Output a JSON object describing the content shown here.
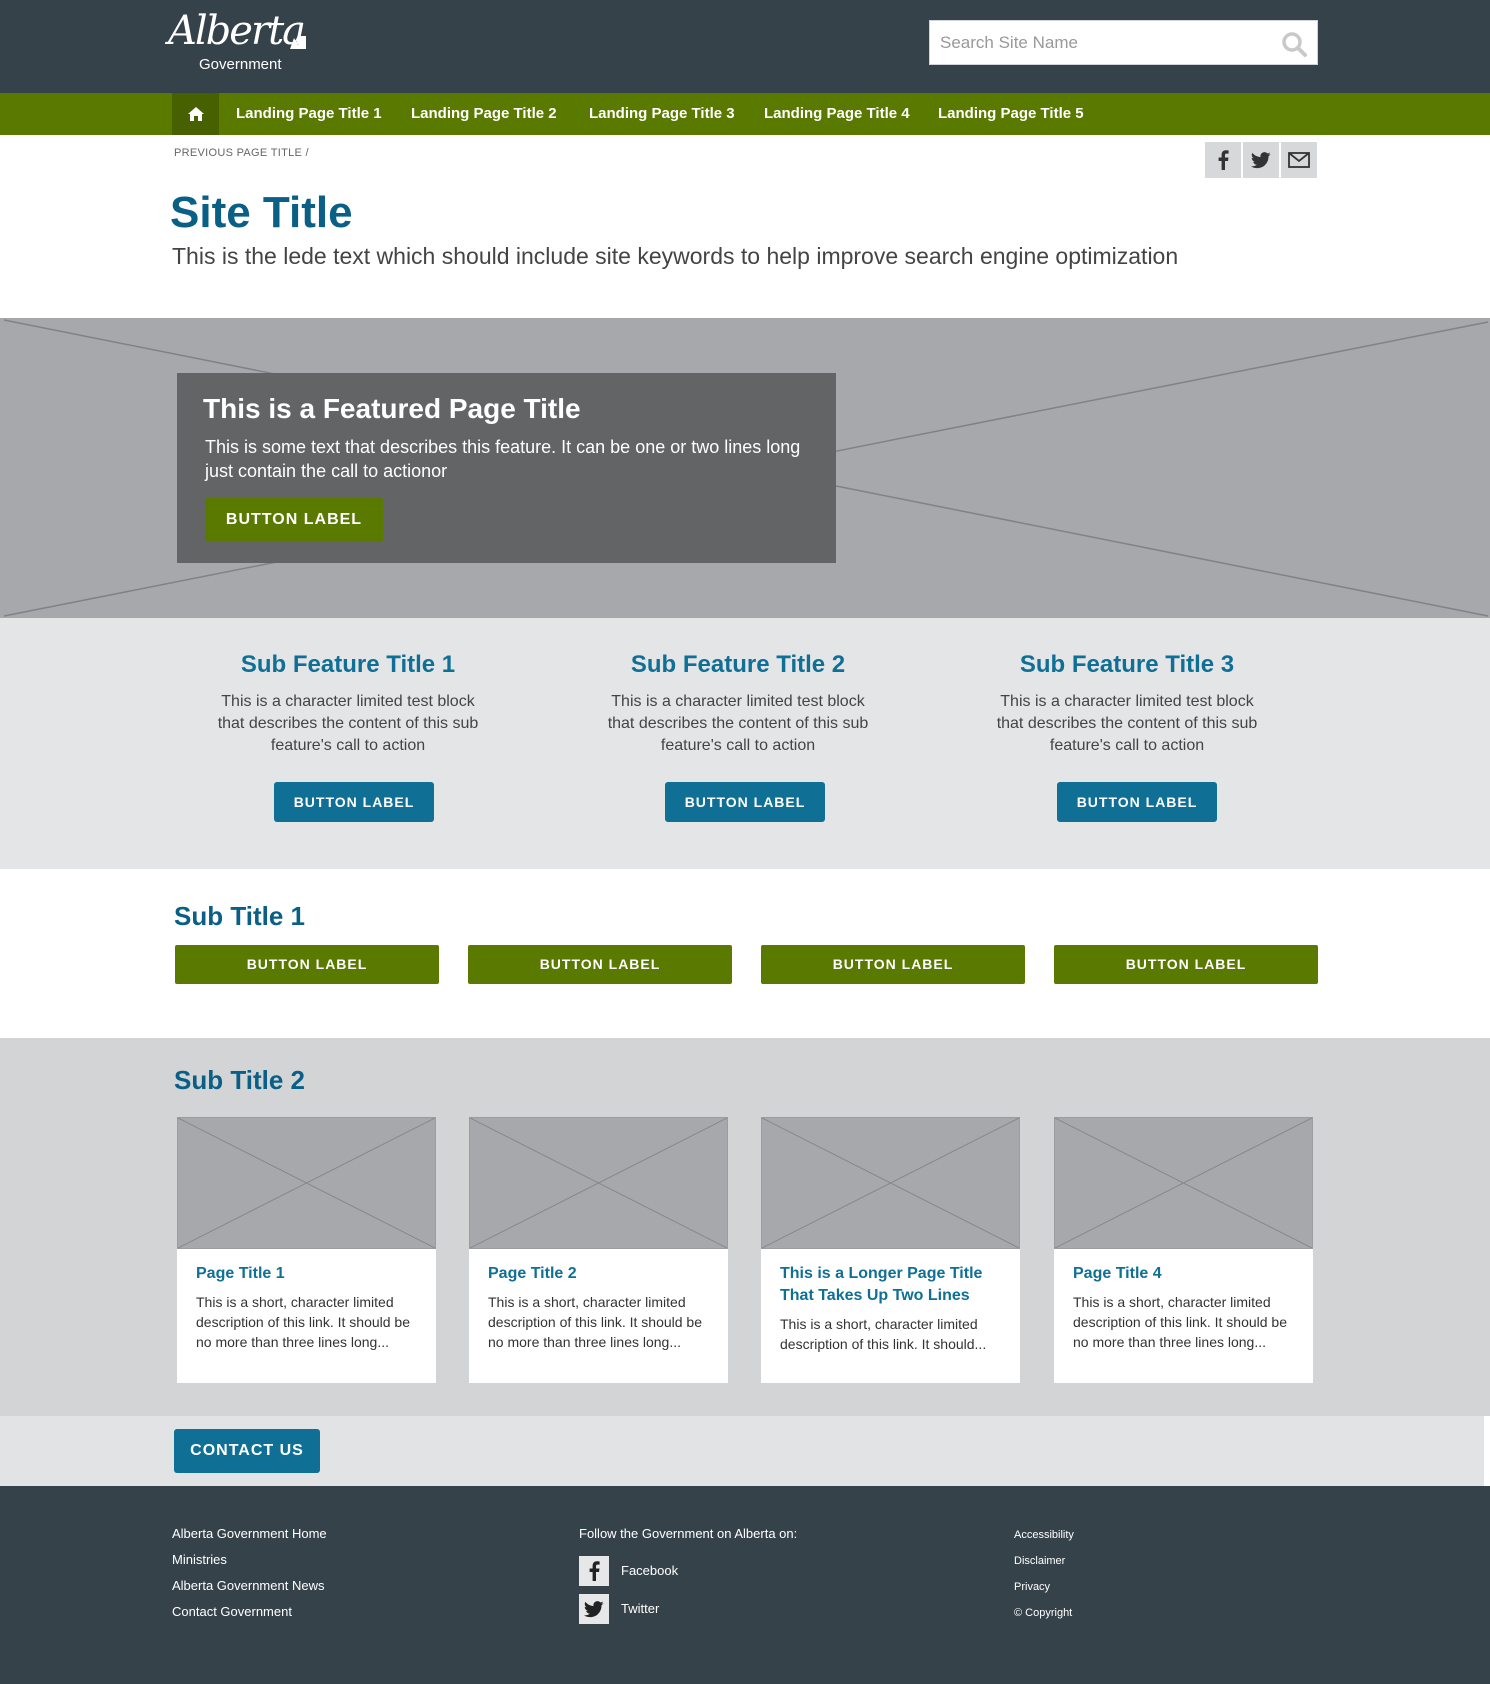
{
  "header": {
    "logo_text": "Alberta",
    "logo_sub": "Government",
    "search_placeholder": "Search Site Name"
  },
  "nav": {
    "items": [
      {
        "label": "Landing Page Title 1"
      },
      {
        "label": "Landing Page Title 2"
      },
      {
        "label": "Landing Page Title 3"
      },
      {
        "label": "Landing Page Title 4"
      },
      {
        "label": "Landing Page Title 5"
      }
    ]
  },
  "breadcrumb": "PREVIOUS PAGE TITLE  /",
  "page": {
    "title": "Site Title",
    "lede": "This is the lede text which should include site keywords to help improve search engine optimization"
  },
  "featured": {
    "title": "This is a Featured Page Title",
    "text": "This is some text that describes this feature. It can be one or two lines long just contain the call to actionor",
    "button": "BUTTON LABEL"
  },
  "subfeatures": [
    {
      "title": "Sub Feature Title 1",
      "text": "This is a character limited test block that describes the content of this sub feature's call to action",
      "button": "BUTTON LABEL"
    },
    {
      "title": "Sub Feature Title 2",
      "text": "This is a character limited test block that describes the content of this sub feature's call to action",
      "button": "BUTTON LABEL"
    },
    {
      "title": "Sub Feature Title 3",
      "text": "This is a character limited test block that describes the content of this sub feature's call to action",
      "button": "BUTTON LABEL"
    }
  ],
  "section1": {
    "title": "Sub Title 1",
    "buttons": [
      "BUTTON LABEL",
      "BUTTON LABEL",
      "BUTTON LABEL",
      "BUTTON LABEL"
    ]
  },
  "section2": {
    "title": "Sub Title 2",
    "cards": [
      {
        "title": "Page Title 1",
        "desc": "This is a short, character limited description of this link. It should be no more than three lines long..."
      },
      {
        "title": "Page Title 2",
        "desc": "This is a short, character limited description of this link. It should be no more than three lines long..."
      },
      {
        "title": "This is a Longer Page Title That Takes Up Two Lines",
        "desc": "This is a short, character limited description of this link. It should..."
      },
      {
        "title": "Page Title 4",
        "desc": "This is a short, character limited description of this link. It should be no more than three lines long..."
      }
    ]
  },
  "contact": {
    "button": "CONTACT US"
  },
  "footer": {
    "links_left": [
      "Alberta Government Home",
      "Ministries",
      "Alberta Government News",
      "Contact Government"
    ],
    "follow_label": "Follow the Government on Alberta on:",
    "social": [
      {
        "label": "Facebook",
        "icon": "facebook-icon"
      },
      {
        "label": "Twitter",
        "icon": "twitter-icon"
      }
    ],
    "links_right": [
      "Accessibility",
      "Disclaimer",
      "Privacy",
      "© Copyright"
    ]
  },
  "colors": {
    "header_bg": "#36424a",
    "nav_green": "#5a7900",
    "title_blue": "#0a5f86",
    "button_blue": "#0f6f95"
  }
}
